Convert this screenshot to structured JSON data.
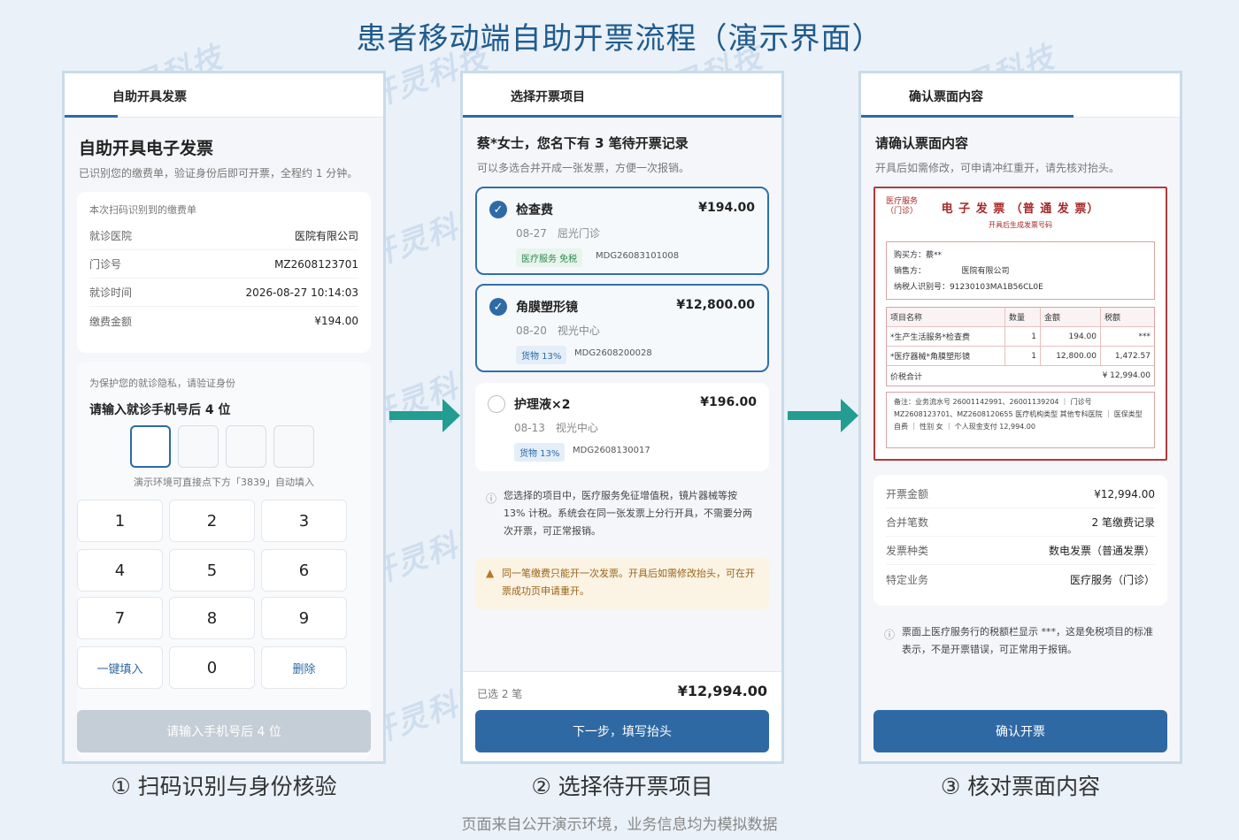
{
  "title": "患者移动端自助开票流程（演示界面）",
  "footer": "页面来自公开演示环境，业务信息均为模拟数据",
  "watermark": "开灵科技",
  "captions": [
    "① 扫码识别与身份核验",
    "② 选择待开票项目",
    "③ 核对票面内容"
  ],
  "screen1": {
    "tab": "自助开具发票",
    "heading": "自助开具电子发票",
    "sub": "已识别您的缴费单，验证身份后即可开票，全程约 1 分钟。",
    "bill_title": "本次扫码识别到的缴费单",
    "rows": [
      {
        "k": "就诊医院",
        "v": "医院有限公司"
      },
      {
        "k": "门诊号",
        "v": "MZ2608123701"
      },
      {
        "k": "就诊时间",
        "v": "2026-08-27 10:14:03"
      },
      {
        "k": "缴费金额",
        "v": "¥194.00"
      }
    ],
    "verify_hint": "为保护您的就诊隐私，请验证身份",
    "verify_title": "请输入就诊手机号后 4 位",
    "demo_hint": "演示环境可直接点下方「3839」自动填入",
    "keys": [
      "1",
      "2",
      "3",
      "4",
      "5",
      "6",
      "7",
      "8",
      "9",
      "一键填入",
      "0",
      "删除"
    ],
    "submit": "请输入手机号后 4 位"
  },
  "screen2": {
    "tab": "选择开票项目",
    "heading": "蔡*女士，您名下有 3 笔待开票记录",
    "sub": "可以多选合并开成一张发票，方便一次报销。",
    "items": [
      {
        "name": "检查费",
        "price": "¥194.00",
        "meta": "08-27　屈光门诊",
        "tag": "医疗服务 免税",
        "code": "MDG26083101008",
        "checked": true
      },
      {
        "name": "角膜塑形镜",
        "price": "¥12,800.00",
        "meta": "08-20　视光中心",
        "tag": "货物 13%",
        "code": "MDG2608200028",
        "checked": true
      },
      {
        "name": "护理液×2",
        "price": "¥196.00",
        "meta": "08-13　视光中心",
        "tag": "货物 13%",
        "code": "MDG2608130017",
        "checked": false
      }
    ],
    "info": "您选择的项目中，医疗服务免征增值税，镜片器械等按 13% 计税。系统会在同一张发票上分行开具，不需要分两次开票，可正常报销。",
    "warn": "同一笔缴费只能开一次发票。开具后如需修改抬头，可在开票成功页申请重开。",
    "selected": "已选 2 笔",
    "total": "¥12,994.00",
    "next": "下一步，填写抬头"
  },
  "screen3": {
    "tab": "确认票面内容",
    "heading": "请确认票面内容",
    "sub": "开具后如需修改，可申请冲红重开，请先核对抬头。",
    "invoice": {
      "corner": "医疗服务\n（门诊）",
      "title": "电 子 发 票 （普 通 发 票）",
      "subtitle": "开具后生成发票号码",
      "buyer": "购买方：蔡**",
      "seller": "销售方：　　　　　医院有限公司",
      "taxid": "纳税人识别号：91230103MA1B56CL0E",
      "headers": [
        "项目名称",
        "数量",
        "金额",
        "税额"
      ],
      "lines": [
        [
          "*生产生活服务*检查费",
          "1",
          "194.00",
          "***"
        ],
        [
          "*医疗器械*角膜塑形镜",
          "1",
          "12,800.00",
          "1,472.57"
        ]
      ],
      "total_label": "价税合计",
      "total": "¥ 12,994.00",
      "remark": "备注：业务流水号 26001142991、26001139204 ｜ 门诊号 MZ2608123701、MZ2608120655 医疗机构类型 其他专科医院 ｜ 医保类型 自费 ｜ 性别 女 ｜ 个人现金支付 12,994.00"
    },
    "rows": [
      {
        "k": "开票金额",
        "v": "¥12,994.00"
      },
      {
        "k": "合并笔数",
        "v": "2 笔缴费记录"
      },
      {
        "k": "发票种类",
        "v": "数电发票（普通发票）"
      },
      {
        "k": "特定业务",
        "v": "医疗服务（门诊）"
      }
    ],
    "info": "票面上医疗服务行的税额栏显示 ***，这是免税项目的标准表示，不是开票错误，可正常用于报销。",
    "confirm": "确认开票"
  }
}
